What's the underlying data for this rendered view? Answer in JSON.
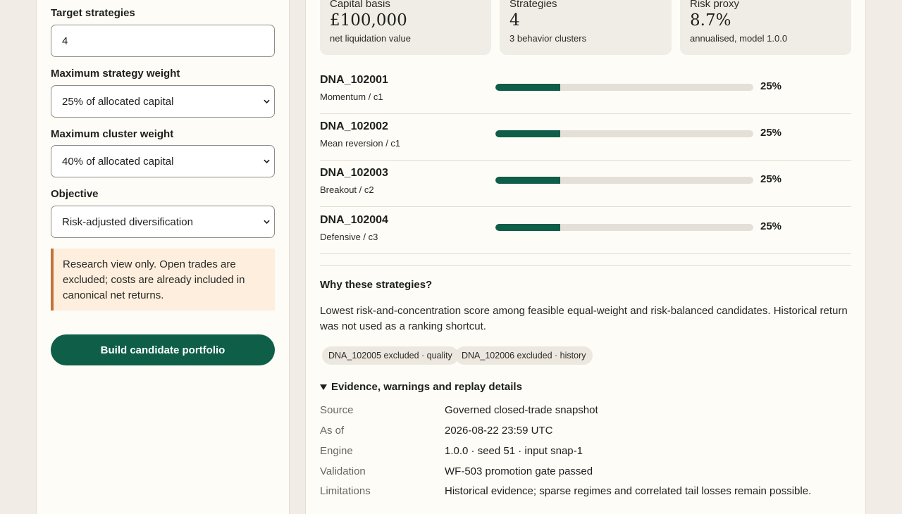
{
  "form": {
    "target_strategies": {
      "label": "Target strategies",
      "value": "4"
    },
    "max_strategy_weight": {
      "label": "Maximum strategy weight",
      "value": "25% of allocated capital"
    },
    "max_cluster_weight": {
      "label": "Maximum cluster weight",
      "value": "40% of allocated capital"
    },
    "objective": {
      "label": "Objective",
      "value": "Risk-adjusted diversification"
    },
    "notice": "Research view only. Open trades are excluded; costs are already included in canonical net returns.",
    "build_button": "Build candidate portfolio"
  },
  "summary": {
    "capital": {
      "label": "Capital basis",
      "value": "£100,000",
      "sub": "net liquidation value"
    },
    "strategies": {
      "label": "Strategies",
      "value": "4",
      "sub": "3 behavior clusters"
    },
    "risk": {
      "label": "Risk proxy",
      "value": "8.7%",
      "sub": "annualised, model 1.0.0"
    }
  },
  "allocations": [
    {
      "name": "DNA_102001",
      "desc": "Momentum / c1",
      "weight_pct": 25,
      "weight_label": "25%"
    },
    {
      "name": "DNA_102002",
      "desc": "Mean reversion / c1",
      "weight_pct": 25,
      "weight_label": "25%"
    },
    {
      "name": "DNA_102003",
      "desc": "Breakout / c2",
      "weight_pct": 25,
      "weight_label": "25%"
    },
    {
      "name": "DNA_102004",
      "desc": "Defensive / c3",
      "weight_pct": 25,
      "weight_label": "25%"
    }
  ],
  "why": {
    "title": "Why these strategies?",
    "text": "Lowest risk-and-concentration score among feasible equal-weight and risk-balanced candidates. Historical return was not used as a ranking shortcut.",
    "chips": [
      "DNA_102005 excluded · quality",
      "DNA_102006 excluded · history"
    ]
  },
  "details": {
    "summary": "Evidence, warnings and replay details",
    "rows": [
      {
        "key": "Source",
        "value": "Governed closed-trade snapshot"
      },
      {
        "key": "As of",
        "value": "2026-08-22 23:59 UTC"
      },
      {
        "key": "Engine",
        "value": "1.0.0 · seed 51 · input snap-1"
      },
      {
        "key": "Validation",
        "value": "WF-503 promotion gate passed"
      },
      {
        "key": "Limitations",
        "value": "Historical evidence; sparse regimes and correlated tail losses remain possible."
      }
    ]
  },
  "colors": {
    "accent": "#0e5e48",
    "warning_border": "#c1743a",
    "warning_bg": "#fdeedd"
  }
}
